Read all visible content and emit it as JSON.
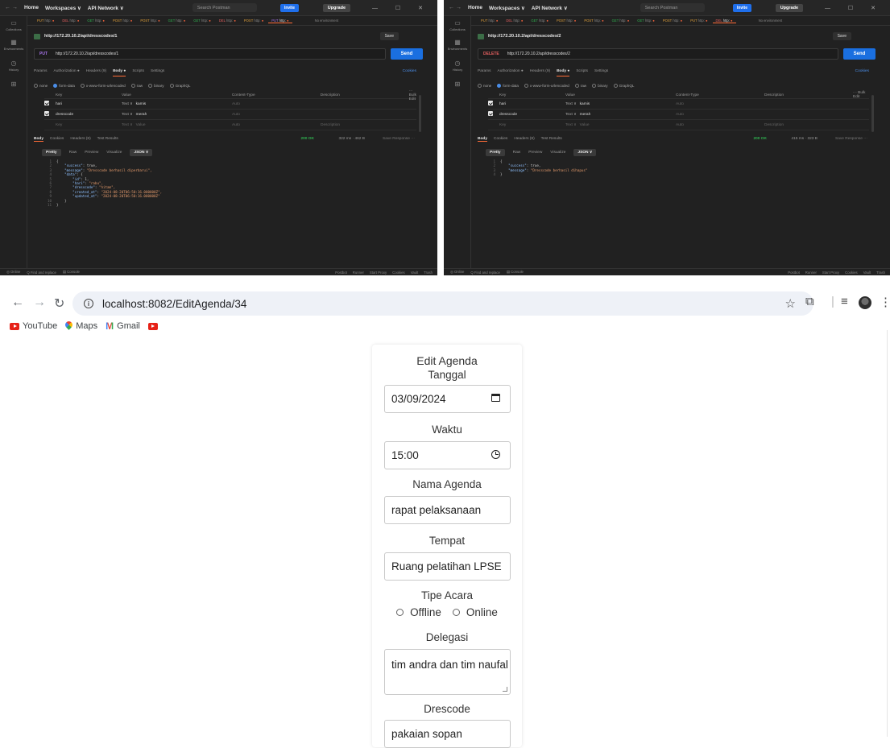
{
  "postman_left": {
    "nav": "← →",
    "home": "Home",
    "workspaces": "Workspaces ∨",
    "api_network": "API Network ∨",
    "search_placeholder": "Search Postman",
    "invite": "Invite",
    "upgrade": "Upgrade",
    "tabs": [
      {
        "method": "PUT",
        "label": "http:",
        "active": false
      },
      {
        "method": "DEL",
        "label": "http:",
        "active": false
      },
      {
        "method": "GET",
        "label": "http:",
        "active": false
      },
      {
        "method": "POST",
        "label": "http:",
        "active": false
      },
      {
        "method": "POST",
        "label": "http:",
        "active": false
      },
      {
        "method": "GET",
        "label": "http:",
        "active": false
      },
      {
        "method": "GET",
        "label": "http:",
        "active": false
      },
      {
        "method": "DEL",
        "label": "http:",
        "active": false
      },
      {
        "method": "POST",
        "label": "http:",
        "active": false
      },
      {
        "method": "PUT",
        "label": "http:",
        "active": true
      }
    ],
    "no_environment": "No environment",
    "request_name": "http://172.20.10.2/api/dresscodes/1",
    "save": "Save",
    "method": "PUT",
    "method_color": "#a673e8",
    "url": "http://172.20.10.2/api/dresscodes/1",
    "send": "Send",
    "req_tabs": [
      "Params",
      "Authorization ●",
      "Headers (9)",
      "Body ●",
      "Scripts",
      "Settings"
    ],
    "cookies": "Cookies",
    "body_types": [
      "none",
      "form-data",
      "x-www-form-urlencoded",
      "raw",
      "binary",
      "GraphQL"
    ],
    "kv_headers": [
      "Key",
      "Value",
      "Content-Type",
      "Description",
      "··· Bulk Edit"
    ],
    "kv_rows": [
      {
        "key": "hari",
        "type": "Text ∨",
        "value": "kamis",
        "ctype": "Auto"
      },
      {
        "key": "dresscode",
        "type": "Text ∨",
        "value": "merah",
        "ctype": "Auto"
      }
    ],
    "kv_placeholder": {
      "key": "Key",
      "type": "Text ∨",
      "value": "Value",
      "ctype": "Auto",
      "desc": "Description"
    },
    "resp_tabs": [
      "Body",
      "Cookies",
      "Headers (8)",
      "Test Results"
    ],
    "status": "200 OK",
    "meta": "322 ms · 462 B",
    "save_response": "Save Response ···",
    "view_tabs": [
      "Pretty",
      "Raw",
      "Preview",
      "Visualize",
      "JSON ∨"
    ],
    "code": [
      "{",
      "    \"success\": true,",
      "    \"message\": \"Dresscode berhasil diperbarui\",",
      "    \"data\": {",
      "        \"id\": 1,",
      "        \"hari\": \"rabu\",",
      "        \"dresscode\": \"hitam\",",
      "        \"created_at\": \"2024-08-20T06:50:16.000000Z\",",
      "        \"updated_at\": \"2024-08-20T06:50:16.000000Z\"",
      "    }",
      "}"
    ],
    "statusbar_left": [
      "◎ Online",
      "Q Find and replace",
      "▤ Console"
    ],
    "statusbar_right": [
      "Postbot",
      "Runner",
      "Start Proxy",
      "Cookies",
      "Vault",
      "Trash"
    ]
  },
  "postman_right": {
    "request_name": "http://172.20.10.2/api/dresscodes/2",
    "method": "DELETE",
    "method_color": "#e35f5f",
    "url": "http://172.20.10.2/api/dresscodes/2",
    "status": "200 OK",
    "meta": "415 ms · 323 B",
    "code": [
      "{",
      "    \"success\": true,",
      "    \"message\": \"Dresscode berhasil dihapus\"",
      "}"
    ]
  },
  "sidebar": [
    "Collections",
    "Environments",
    "History"
  ],
  "browser": {
    "url": "localhost:8082/EditAgenda/34",
    "bookmarks": [
      "YouTube",
      "Maps",
      "Gmail"
    ]
  },
  "form": {
    "title": "Edit Agenda",
    "tanggal_label": "Tanggal",
    "tanggal_value": "03/09/2024",
    "waktu_label": "Waktu",
    "waktu_value": "15:00",
    "nama_label": "Nama Agenda",
    "nama_value": "rapat pelaksanaan",
    "tempat_label": "Tempat",
    "tempat_value": "Ruang pelatihan LPSE",
    "tipe_label": "Tipe Acara",
    "tipe_offline": "Offline",
    "tipe_online": "Online",
    "delegasi_label": "Delegasi",
    "delegasi_value": "tim andra dan tim naufal",
    "drescode_label": "Drescode",
    "drescode_value": "pakaian sopan"
  }
}
